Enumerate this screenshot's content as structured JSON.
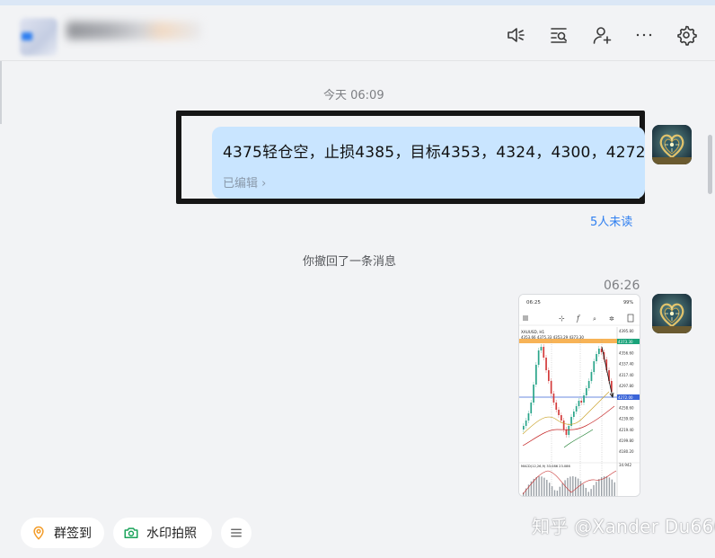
{
  "header": {
    "icons": [
      "speaker-icon",
      "search-history-icon",
      "add-member-icon",
      "more-icon",
      "settings-icon"
    ]
  },
  "chat": {
    "time1": "今天 06:09",
    "message1": {
      "text": "4375轻仓空，止损4385，目标4353，4324，4300，4272",
      "edited_label": "已编辑",
      "read_status": "5人未读"
    },
    "recall_notice": "你撤回了一条消息",
    "time2": "06:26",
    "image_message": {
      "status_time": "06:25",
      "battery": "99%",
      "symbol": "XAUUSD, H1",
      "ohlc": "4353.66 4375.33 4353.29 4373.30",
      "price_levels": [
        "4395.80",
        "4376.50",
        "4356.60",
        "4337.40",
        "4317.40",
        "4297.80",
        "4278.20",
        "4258.60",
        "4239.00",
        "4219.40",
        "4199.80",
        "4180.20"
      ],
      "current_price": "4373.30",
      "last_price": "4272.00",
      "macd_label": "MACD(12,26,9) 33.086 23.086",
      "macd_value": "34.942"
    }
  },
  "bottom": {
    "checkin_label": "群签到",
    "watermark_photo_label": "水印拍照"
  },
  "watermark_text": "知乎 @Xander Du666",
  "colors": {
    "bubble": "#c9e5ff",
    "accent": "#2f7ff0",
    "checkin": "#f39c28",
    "photo": "#1aa35a"
  }
}
